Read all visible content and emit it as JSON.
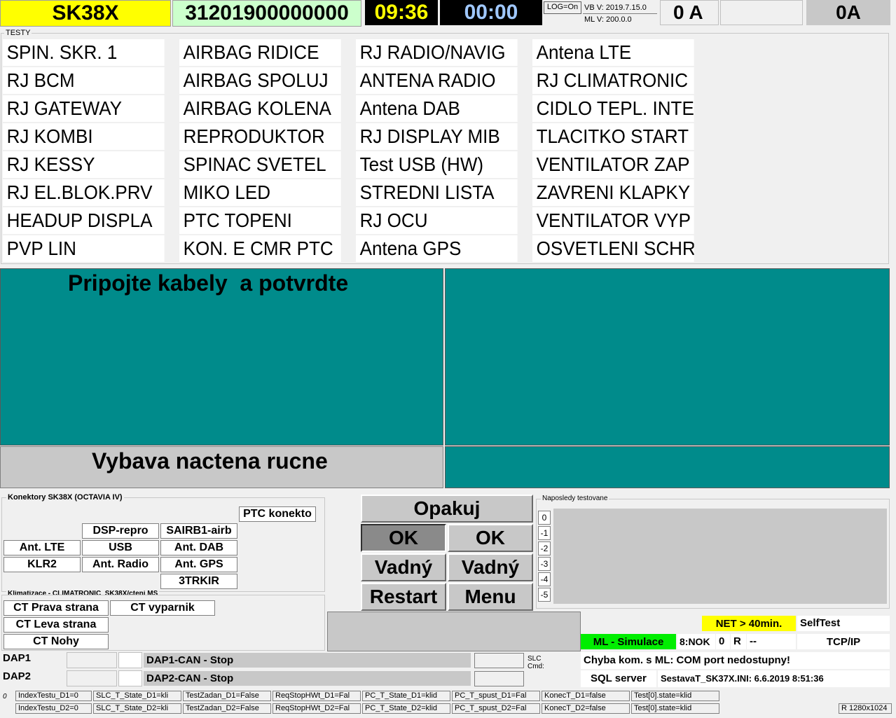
{
  "header": {
    "model": "SK38X",
    "serial": "31201900000000",
    "clock": "09:36",
    "timer": "00:00",
    "log": "LOG=On",
    "vb_version": "VB V: 2019.7.15.0",
    "ml_version": "ML V: 200.0.0",
    "current_a": "0 A",
    "current_b": "0A",
    "colors": {
      "model_bg": "#ffff00",
      "serial_bg": "#ccffcc",
      "clock_bg": "#000000",
      "clock_fg": "#ffff00",
      "timer_fg": "#a0c8ff"
    }
  },
  "tests_group_title": "TESTY",
  "tests": [
    [
      "SPIN. SKR. 1",
      "AIRBAG RIDICE",
      "RJ RADIO/NAVIG",
      "Antena LTE"
    ],
    [
      "RJ BCM",
      "AIRBAG SPOLUJ",
      "ANTENA RADIO",
      "RJ CLIMATRONIC"
    ],
    [
      "RJ GATEWAY",
      "AIRBAG KOLENA",
      "Antena DAB",
      "CIDLO TEPL. INTE"
    ],
    [
      "RJ KOMBI",
      "REPRODUKTOR",
      "RJ DISPLAY MIB",
      "TLACITKO START"
    ],
    [
      "RJ KESSY",
      "SPINAC SVETEL",
      "Test USB (HW)",
      "VENTILATOR ZAP"
    ],
    [
      "RJ EL.BLOK.PRV",
      "MIKO LED",
      "STREDNI LISTA",
      "ZAVRENI KLAPKY"
    ],
    [
      "HEADUP DISPLA",
      "PTC TOPENI",
      "RJ OCU",
      "VENTILATOR VYP"
    ],
    [
      "PVP LIN",
      "KON. E CMR PTC",
      "Antena GPS",
      "OSVETLENI SCHR"
    ]
  ],
  "message": {
    "main": "Pripojte kabely  a potvrdte",
    "sub": "Vybava nactena rucne",
    "color": "#008b8b"
  },
  "connectors": {
    "title": "Konektory SK38X (OCTAVIA IV)",
    "ptc": "PTC konekto",
    "dsp": "DSP-repro",
    "sairb": "SAIRB1-airb",
    "ant_lte": "Ant. LTE",
    "usb": "USB",
    "ant_dab": "Ant. DAB",
    "klr2": "KLR2",
    "ant_radio": "Ant. Radio",
    "ant_gps": "Ant. GPS",
    "trkir": "3TRKIR"
  },
  "climate": {
    "title": "Klimatizace - CLIMATRONIC_SK38X/cteni MS",
    "prava": "CT Prava strana",
    "vyparnik": "CT vyparnik",
    "leva": "CT Leva strana",
    "nohy": "CT Nohy"
  },
  "buttons": {
    "opakuj": "Opakuj",
    "ok1": "OK",
    "ok2": "OK",
    "vadny1": "Vadný",
    "vadny2": "Vadný",
    "restart": "Restart",
    "menu": "Menu"
  },
  "recent": {
    "title": "Naposledy testovane",
    "indices": [
      "0",
      "-1",
      "-2",
      "-3",
      "-4",
      "-5"
    ]
  },
  "status": {
    "net": "NET > 40min.",
    "selftest": "SelfTest",
    "ml_sim": "ML - Simulace",
    "nok": "8:NOK",
    "zero": "0",
    "r": "R",
    "dash": "--",
    "tcpip": "TCP/IP",
    "slc_cmd": "SLC\nCmd:",
    "error": "Chyba kom. s ML: COM port nedostupny!",
    "sql": "SQL server",
    "ini": "SestavaT_SK37X.INI: 6.6.2019 8:51:36"
  },
  "dap": {
    "dap1": "DAP1",
    "dap2": "DAP2",
    "dap1_can": "DAP1-CAN - Stop",
    "dap2_can": "DAP2-CAN - Stop"
  },
  "footer": {
    "zero": "0",
    "row1": [
      "IndexTestu_D1=0",
      "SLC_T_State_D1=kli",
      "TestZadan_D1=False",
      "ReqStopHWt_D1=Fal",
      "PC_T_State_D1=klid",
      "PC_T_spust_D1=Fal",
      "KonecT_D1=false",
      "Test[0].state=klid"
    ],
    "row2": [
      "IndexTestu_D2=0",
      "SLC_T_State_D2=kli",
      "TestZadan_D2=False",
      "ReqStopHWt_D2=Fal",
      "PC_T_State_D2=klid",
      "PC_T_spust_D2=Fal",
      "KonecT_D2=false",
      "Test[0].state=klid"
    ],
    "resolution": "R 1280x1024"
  }
}
